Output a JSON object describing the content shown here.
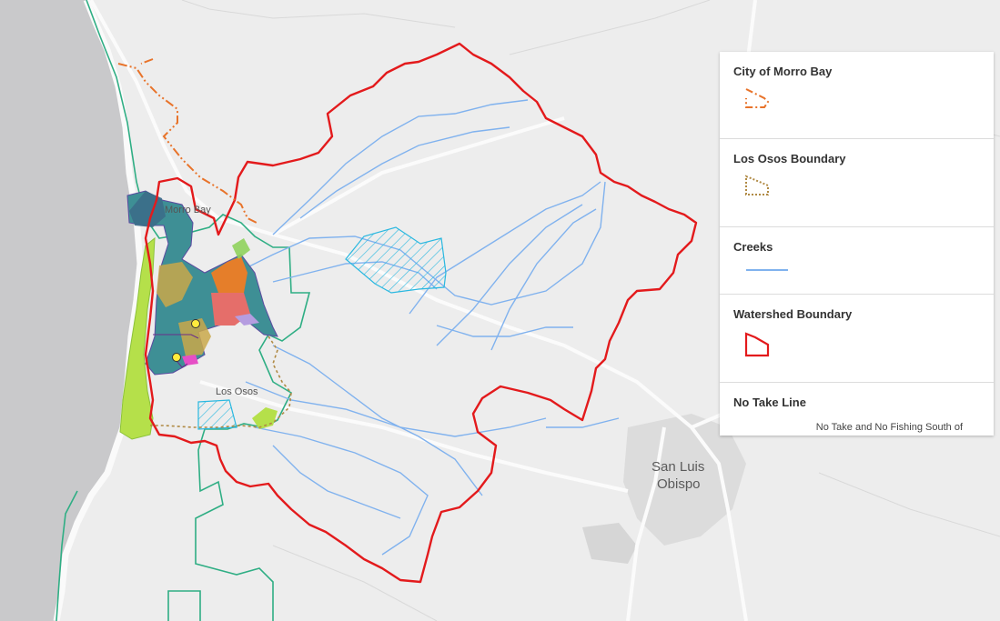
{
  "map": {
    "labels": {
      "morro_bay": "Morro Bay",
      "los_osos": "Los Osos",
      "san_luis_line1": "San Luis",
      "san_luis_line2": "Obispo"
    }
  },
  "colors": {
    "watershed": "#e31a1c",
    "creeks": "#7fb0ec",
    "morro_bay_boundary": "#e8732a",
    "los_osos_boundary": "#b08a44",
    "habitat_outline": "#2fae84",
    "hatch": "#2ab8e0"
  },
  "legend": {
    "items": [
      {
        "title": "City of Morro Bay",
        "swatch": "dashed-polygon-orange"
      },
      {
        "title": "Los Osos Boundary",
        "swatch": "dotted-polygon-tan"
      },
      {
        "title": "Creeks",
        "swatch": "blue-line"
      },
      {
        "title": "Watershed Boundary",
        "swatch": "red-polygon"
      },
      {
        "title": "No Take Line",
        "sub": "No Take and No Fishing South of"
      }
    ]
  }
}
